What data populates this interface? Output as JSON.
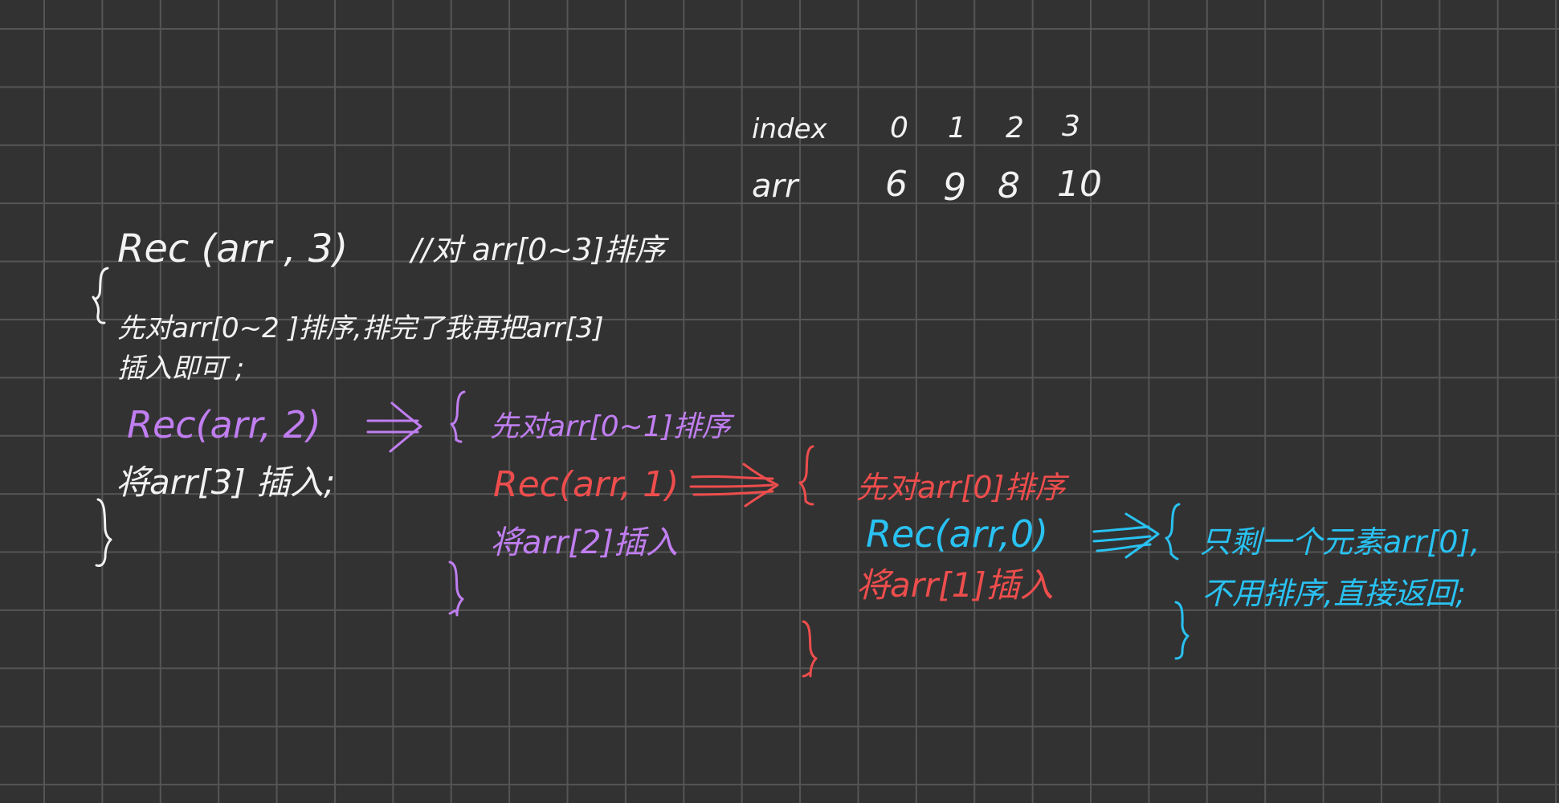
{
  "table": {
    "row_labels": [
      "index",
      "arr"
    ],
    "index_values": [
      "0",
      "1",
      "2",
      "3"
    ],
    "arr_values": [
      "6",
      "9",
      "8",
      "10"
    ]
  },
  "level3": {
    "call": "Rec (arr , 3)",
    "comment": "//对 arr[0~3]排序",
    "step1_line1": "先对arr[0~2 ]排序,排完了我再把arr[3]",
    "step1_line2": "插入即可 ;",
    "step2": "将arr[3] 插入;"
  },
  "level2": {
    "call": "Rec(arr, 2)",
    "step1": "先对arr[0~1]排序",
    "step2": "将arr[2]插入"
  },
  "level1": {
    "call": "Rec(arr, 1)",
    "step1": "先对arr[0]排序",
    "step2": "将arr[1]插入"
  },
  "level0": {
    "call": "Rec(arr,0)",
    "line1": "只剩一个元素arr[0],",
    "line2": "不用排序,直接返回;"
  },
  "colors": {
    "background": "#323232",
    "grid": "#555555",
    "white_ink": "#f2f2f2",
    "purple_ink": "#c07ef0",
    "red_ink": "#ee4d4d",
    "blue_ink": "#29c2f2"
  }
}
